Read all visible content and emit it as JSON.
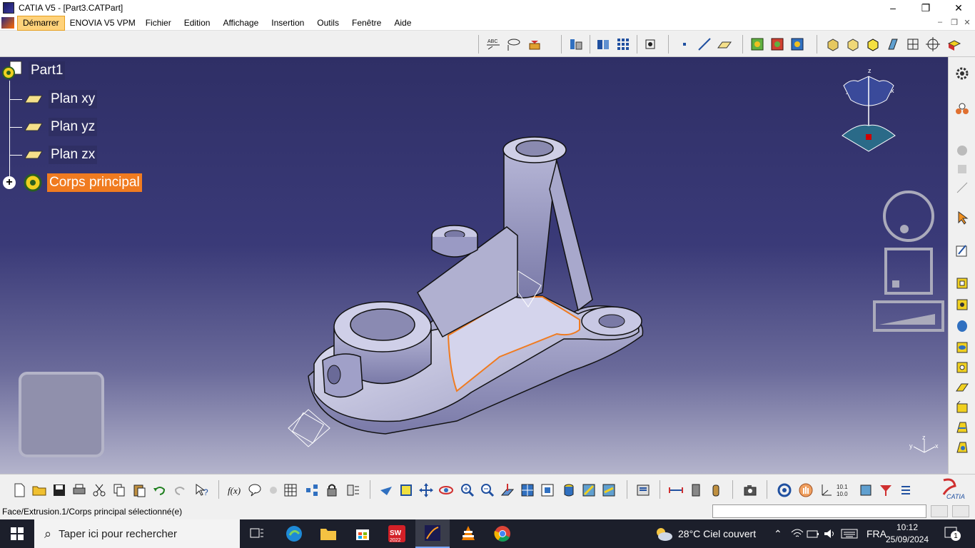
{
  "window": {
    "title": "CATIA V5 - [Part3.CATPart]",
    "minimize": "–",
    "maximize": "❐",
    "close": "✕"
  },
  "menu": {
    "items": [
      "Démarrer",
      "ENOVIA V5 VPM",
      "Fichier",
      "Edition",
      "Affichage",
      "Insertion",
      "Outils",
      "Fenêtre",
      "Aide"
    ],
    "active_index": 0,
    "mdi_min": "–",
    "mdi_restore": "❐",
    "mdi_close": "✕"
  },
  "tree": {
    "root": "Part1",
    "children": [
      "Plan xy",
      "Plan yz",
      "Plan zx"
    ],
    "body": "Corps principal",
    "body_expand": "+"
  },
  "compass": {
    "z_label": "z",
    "x_label": "x",
    "y_label": "y"
  },
  "axis_triad": {
    "z_label": "z",
    "x_label": "x",
    "y_label": "y"
  },
  "status": {
    "message": "Face/Extrusion.1/Corps principal sélectionné(e)",
    "command_value": ""
  },
  "taskbar": {
    "search_placeholder": "Taper ici pour rechercher",
    "weather": "28°C  Ciel couvert",
    "language": "FRA",
    "time": "10:12",
    "date": "25/09/2024",
    "notification_count": "1",
    "solidworks_label": "2022"
  },
  "toolbar_text": {
    "text_tool": "ABC",
    "measure_small": "10.1",
    "measure_small2": "10.0",
    "fx": "f(x)",
    "catia_logo": "CATIA"
  },
  "colors": {
    "selection": "#f07b20",
    "viewport_top": "#2f2f66",
    "viewport_bottom": "#b4b4cc",
    "part_fill": "#c8c8e0"
  }
}
